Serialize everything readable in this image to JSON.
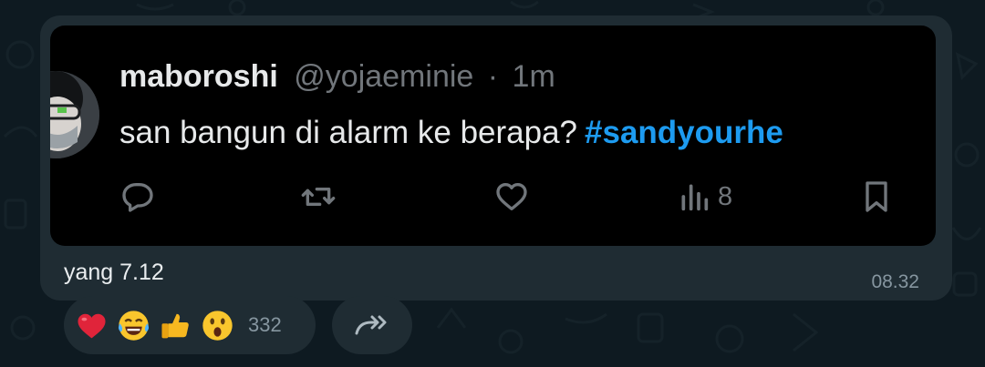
{
  "tweet": {
    "display_name": "maboroshi",
    "handle": "@yojaeminie",
    "separator": "·",
    "time": "1m",
    "text": "san bangun di alarm ke berapa?",
    "hashtag": "#sandyourhe",
    "views": "8",
    "icons": [
      "reply-icon",
      "retweet-icon",
      "like-icon",
      "views-icon",
      "bookmark-icon"
    ]
  },
  "message": {
    "caption": "yang 7.12",
    "timestamp": "08.32"
  },
  "reactions": {
    "emojis": [
      "heart",
      "tears-of-joy",
      "thumbs-up",
      "astonished-face"
    ],
    "count": "332"
  },
  "colors": {
    "background": "#0e1a21",
    "bubble": "#1f2c33",
    "tweet_bg": "#000000",
    "hashtag": "#1d9bf0",
    "muted": "#71767b"
  }
}
